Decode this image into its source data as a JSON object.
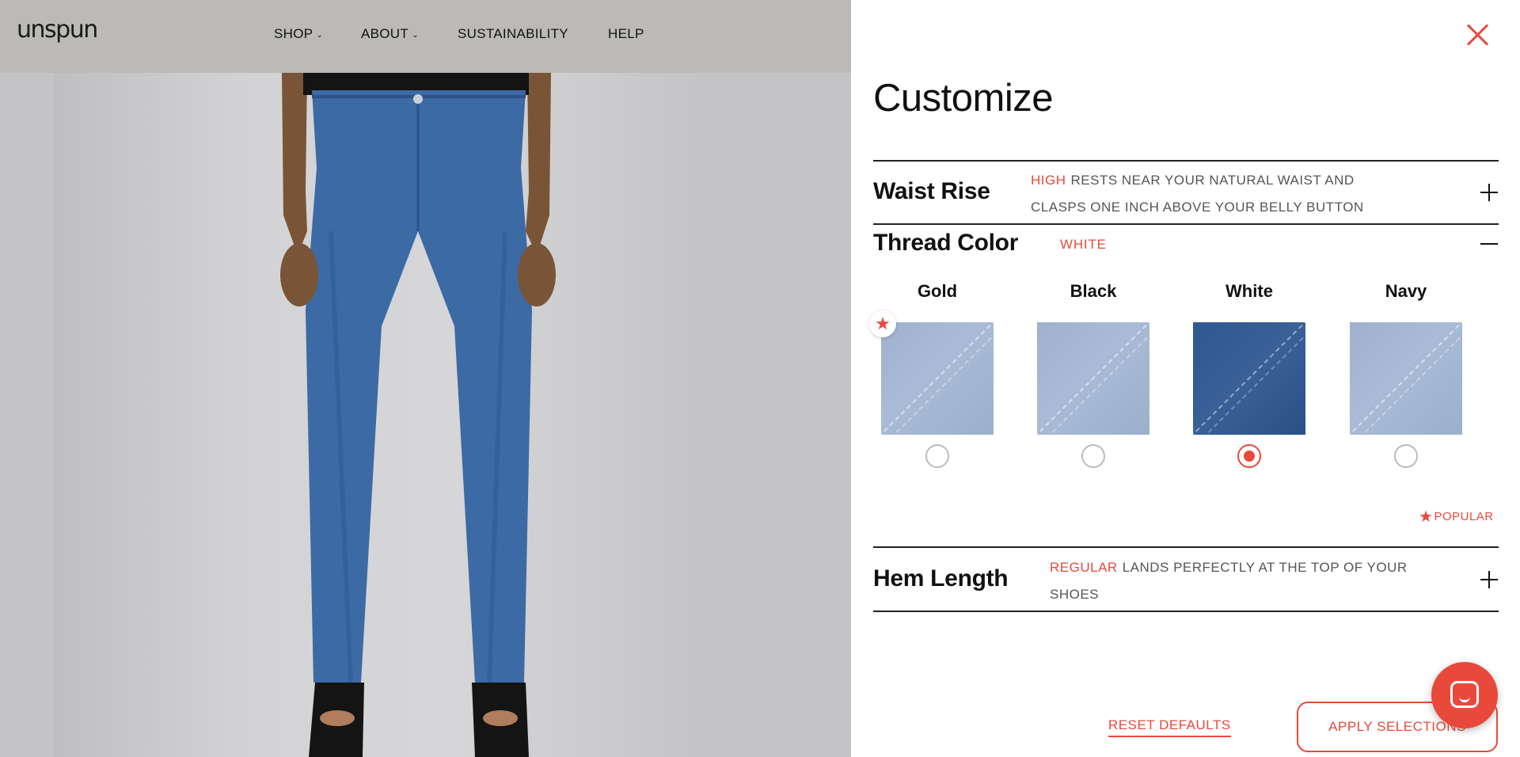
{
  "header": {
    "logo": "unspun",
    "nav": [
      {
        "label": "SHOP",
        "has_dropdown": true
      },
      {
        "label": "ABOUT",
        "has_dropdown": true
      },
      {
        "label": "SUSTAINABILITY",
        "has_dropdown": false
      },
      {
        "label": "HELP",
        "has_dropdown": false
      }
    ]
  },
  "drawer": {
    "title": "Customize",
    "sections": {
      "waist_rise": {
        "title": "Waist Rise",
        "value": "HIGH",
        "description_line1": "RESTS NEAR YOUR NATURAL WAIST AND",
        "description_line2": "CLASPS ONE INCH ABOVE YOUR BELLY BUTTON",
        "expanded": false
      },
      "thread_color": {
        "title": "Thread Color",
        "value": "WHITE",
        "expanded": true,
        "options": [
          {
            "label": "Gold",
            "selected": false,
            "popular": true,
            "swatch": "light"
          },
          {
            "label": "Black",
            "selected": false,
            "popular": false,
            "swatch": "light"
          },
          {
            "label": "White",
            "selected": true,
            "popular": false,
            "swatch": "dark"
          },
          {
            "label": "Navy",
            "selected": false,
            "popular": false,
            "swatch": "light"
          }
        ],
        "legend": "POPULAR"
      },
      "hem_length": {
        "title": "Hem Length",
        "value": "REGULAR",
        "description_line1": "LANDS PERFECTLY AT THE TOP OF YOUR",
        "description_line2": "SHOES",
        "expanded": false
      }
    },
    "reset_label": "RESET DEFAULTS",
    "apply_label": "APPLY SELECTIONS"
  },
  "colors": {
    "accent": "#e8493b",
    "denim_light": "#a3b5cf",
    "denim_dark": "#33598f",
    "header_dim": "#bcbab6"
  }
}
